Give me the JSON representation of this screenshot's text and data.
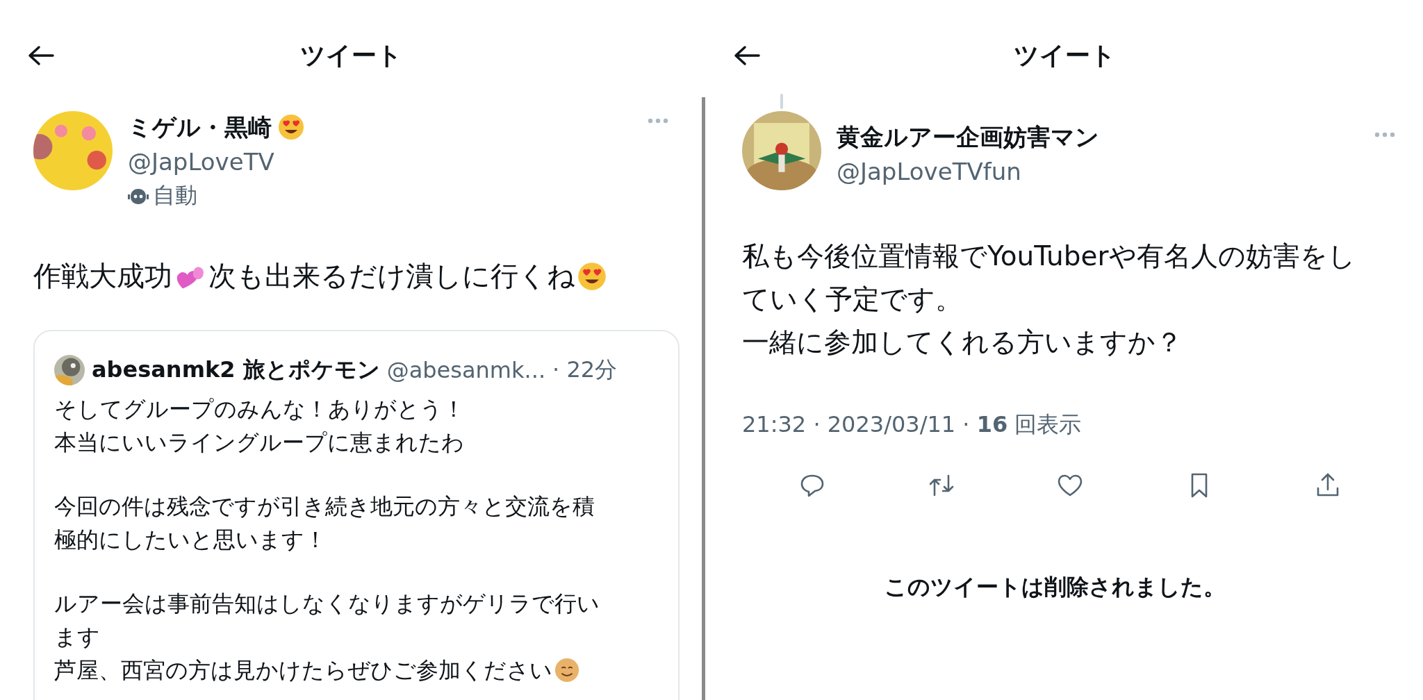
{
  "left": {
    "header": {
      "title": "ツイート"
    },
    "author": {
      "name": "ミゲル・黒崎",
      "name_emoji": {
        "kind": "heart_eyes"
      },
      "handle": "@JapLoveTV",
      "label": "自動"
    },
    "tweet": [
      {
        "kind": "text",
        "text": "作戦大成功"
      },
      {
        "kind": "hearts"
      },
      {
        "kind": "text",
        "text": "次も出来るだけ潰しに行くね"
      },
      {
        "kind": "heart_eyes"
      }
    ],
    "quote": {
      "name": "abesanmk2 旅とポケモン",
      "handle": "@abesanmk...",
      "time": "· 22分",
      "paragraphs": [
        [
          {
            "text": "そしてグループのみんな！ありがとう！"
          },
          {
            "text": "本当にいいライングループに恵まれたわ"
          }
        ],
        [
          {
            "text": "今回の件は残念ですが引き続き地元の方々と交流を積"
          },
          {
            "text": "極的にしたいと思います！"
          }
        ],
        [
          {
            "text": "ルアー会は事前告知はしなくなりますがゲリラで行い"
          },
          {
            "text": "ます"
          },
          {
            "text": "芦屋、西宮の方は見かけたらぜひご参加ください",
            "emoji": {
              "kind": "smile"
            }
          }
        ]
      ]
    }
  },
  "right": {
    "header": {
      "title": "ツイート"
    },
    "author": {
      "name": "黄金ルアー企画妨害マン",
      "handle": "@JapLoveTVfun"
    },
    "tweet_lines": [
      "私も今後位置情報でYouTuberや有名人の妨害をし",
      "ていく予定です。",
      "一緒に参加してくれる方いますか？"
    ],
    "meta": "21:32 · 2023/03/11 · **16** 回表示",
    "actions": [
      {
        "kind": "reply"
      },
      {
        "kind": "retweet"
      },
      {
        "kind": "like"
      },
      {
        "kind": "bookmark"
      },
      {
        "kind": "share"
      }
    ],
    "deleted_notice": "このツイートは削除されました。"
  }
}
